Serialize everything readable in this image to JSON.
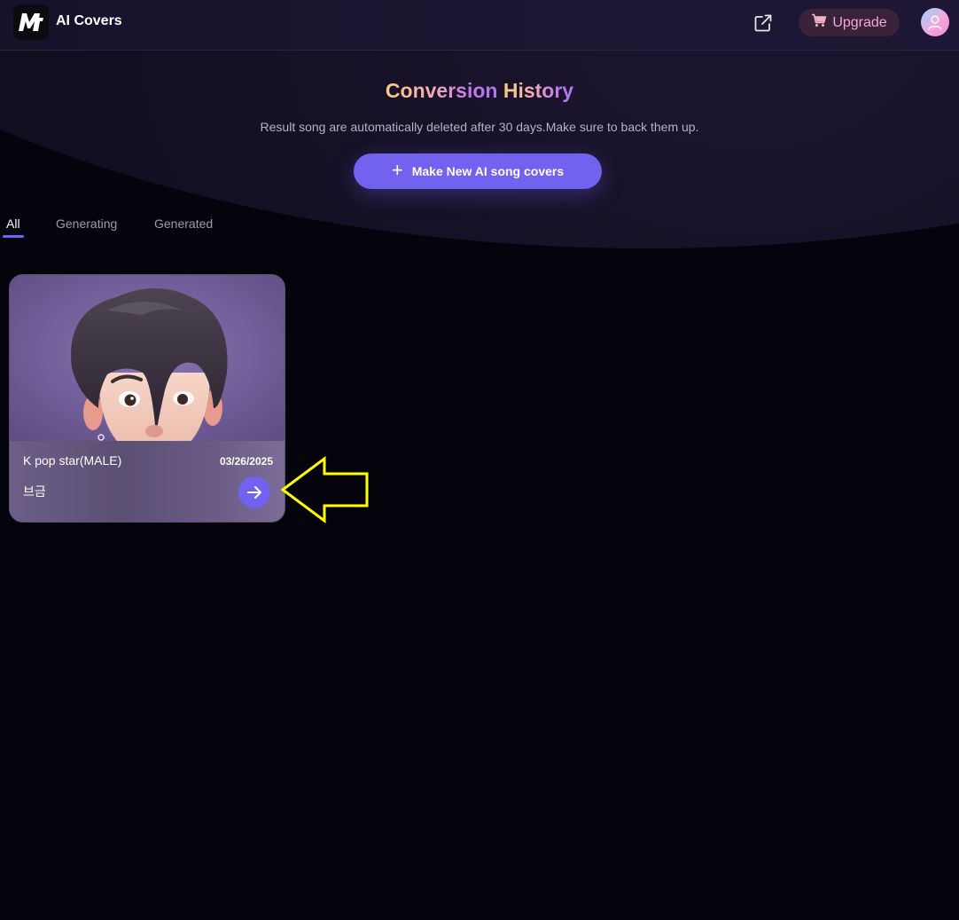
{
  "header": {
    "app_title": "AI Covers",
    "logo_text": "M",
    "upgrade_label": "Upgrade",
    "icons": [
      "app-logo-icon",
      "share-icon",
      "cart-icon",
      "user-avatar-icon"
    ]
  },
  "main": {
    "title_part1": "Conversion",
    "title_part2": "History",
    "subtitle": "Result song are automatically deleted after 30 days.Make sure to back them up.",
    "make_button_label": "Make New AI song covers"
  },
  "tabs": [
    {
      "label": "All",
      "active": true
    },
    {
      "label": "Generating",
      "active": false
    },
    {
      "label": "Generated",
      "active": false
    }
  ],
  "cards": [
    {
      "voice_name": "K pop star(MALE)",
      "date": "03/26/2025",
      "song_name": "브금"
    }
  ],
  "colors": {
    "accent": "#7163f0",
    "background": "#05040d",
    "upgrade_text": "#f0a8d8",
    "annotation": "#ffff00"
  }
}
